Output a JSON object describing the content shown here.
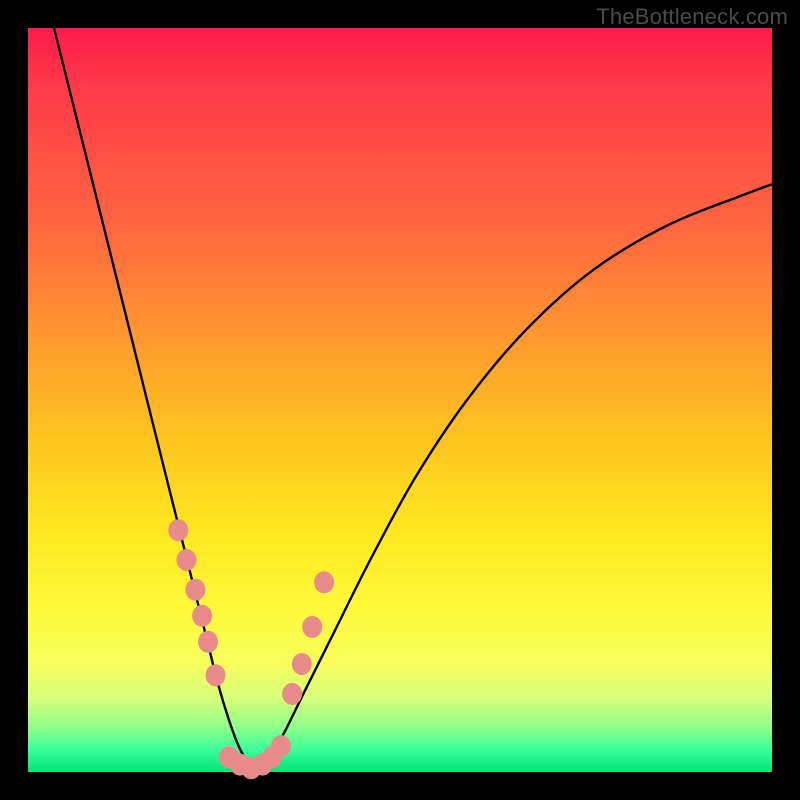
{
  "watermark": "TheBottleneck.com",
  "chart_data": {
    "type": "line",
    "title": "",
    "xlabel": "",
    "ylabel": "",
    "xlim": [
      0,
      1
    ],
    "ylim": [
      0,
      1
    ],
    "description": "V-shaped bottleneck curve over a vertical color gradient (red=high bottleneck at top, green=no bottleneck at bottom). Both axes unlabeled; values are normalized 0–1.",
    "series": [
      {
        "name": "bottleneck-curve",
        "x": [
          0.035,
          0.07,
          0.1,
          0.13,
          0.16,
          0.185,
          0.205,
          0.225,
          0.24,
          0.255,
          0.27,
          0.283,
          0.295,
          0.3,
          0.315,
          0.34,
          0.37,
          0.41,
          0.46,
          0.52,
          0.59,
          0.67,
          0.76,
          0.86,
          0.96,
          1.0
        ],
        "y": [
          1.0,
          0.86,
          0.74,
          0.62,
          0.5,
          0.4,
          0.32,
          0.24,
          0.18,
          0.12,
          0.07,
          0.035,
          0.012,
          0.0,
          0.012,
          0.045,
          0.105,
          0.185,
          0.285,
          0.395,
          0.5,
          0.595,
          0.675,
          0.735,
          0.775,
          0.79
        ]
      },
      {
        "name": "markers-left",
        "x": [
          0.202,
          0.213,
          0.225,
          0.234,
          0.242,
          0.252
        ],
        "y": [
          0.325,
          0.285,
          0.245,
          0.21,
          0.175,
          0.13
        ]
      },
      {
        "name": "markers-right",
        "x": [
          0.355,
          0.368,
          0.382,
          0.398
        ],
        "y": [
          0.105,
          0.145,
          0.195,
          0.255
        ]
      },
      {
        "name": "markers-bottom",
        "x": [
          0.27,
          0.285,
          0.3,
          0.315,
          0.328,
          0.34
        ],
        "y": [
          0.02,
          0.01,
          0.005,
          0.01,
          0.02,
          0.035
        ]
      }
    ],
    "marker_color": "#e98b8b",
    "curve_color": "#000000",
    "gradient_stops": [
      {
        "pos": 0.0,
        "color": "#ff1a4a"
      },
      {
        "pos": 0.28,
        "color": "#ff6a3f"
      },
      {
        "pos": 0.55,
        "color": "#ffc420"
      },
      {
        "pos": 0.78,
        "color": "#fff93a"
      },
      {
        "pos": 0.94,
        "color": "#8fff8a"
      },
      {
        "pos": 1.0,
        "color": "#00e37a"
      }
    ]
  }
}
